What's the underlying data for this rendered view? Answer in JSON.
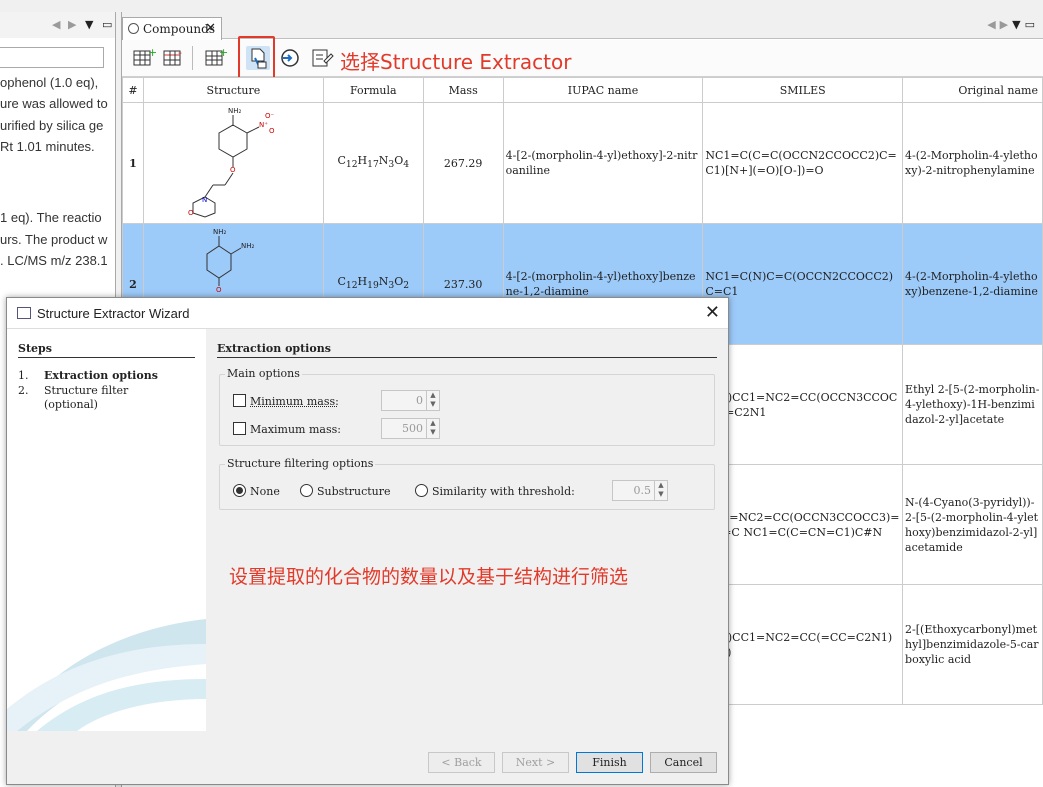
{
  "left_doc": {
    "lines": [
      "ophenol (1.0 eq),",
      "ure was allowed to",
      "urified by silica ge",
      "Rt 1.01 minutes.",
      "1 eq). The reactio",
      "urs. The product w",
      ". LC/MS m/z 238.1"
    ]
  },
  "editor": {
    "tab_label": "Compounds",
    "annotation": "选择Structure Extractor",
    "columns": [
      "#",
      "Structure",
      "Formula",
      "Mass",
      "IUPAC name",
      "SMILES",
      "Original name"
    ],
    "rows": [
      {
        "num": "1",
        "formula_html": "C<sub>12</sub>H<sub>17</sub>N<sub>3</sub>O<sub>4</sub>",
        "mass": "267.29",
        "iupac": "4-[2-(morpholin-4-yl)ethoxy]-2-nitroaniline",
        "smiles": "NC1=C(C=C(OCCN2CCOCC2)C=C1)[N+](=O)[O-])=O",
        "original": "4-(2-Morpholin-4-ylethoxy)-2-nitrophenylamine"
      },
      {
        "num": "2",
        "formula_html": "C<sub>12</sub>H<sub>19</sub>N<sub>3</sub>O<sub>2</sub>",
        "mass": "237.30",
        "iupac": "4-[2-(morpholin-4-yl)ethoxy]benzene-1,2-diamine",
        "smiles": "NC1=C(N)C=C(OCCN2CCOCC2)C=C1",
        "original": "4-(2-Morpholin-4-ylethoxy)benzene-1,2-diamine"
      },
      {
        "num": "3",
        "formula_html": "",
        "mass": "",
        "iupac": "",
        "smiles": "(=O)CC1=NC2=CC(OCCN3CCOCC3)=C2N1",
        "original": "Ethyl 2-[5-(2-morpholin-4-ylethoxy)-1H-benzimidazol-2-yl]acetate"
      },
      {
        "num": "4",
        "formula_html": "",
        "mass": "",
        "iupac": "",
        "smiles": "CC1=NC2=CC(OCCN3CCOCC3)=CC=C NC1=C(C=CN=C1)C#N",
        "original": "N-(4-Cyano(3-pyridyl))-2-[5-(2-morpholin-4-ylethoxy)benzimidazol-2-yl]acetamide"
      },
      {
        "num": "5",
        "formula_html": "",
        "mass": "",
        "iupac": "",
        "smiles": "(=O)CC1=NC2=CC(=CC=C2N1)C(O)",
        "original": "2-[(Ethoxycarbonyl)methyl]benzimidazole-5-carboxylic acid"
      }
    ]
  },
  "dialog": {
    "title": "Structure Extractor Wizard",
    "steps_header": "Steps",
    "steps": [
      {
        "n": "1.",
        "label": "Extraction options",
        "active": true
      },
      {
        "n": "2.",
        "label": "Structure filter (optional)",
        "active": false
      }
    ],
    "content_header": "Extraction options",
    "main_options_title": "Main options",
    "min_mass_label": "Minimum mass:",
    "min_mass_value": "0",
    "max_mass_label": "Maximum mass:",
    "max_mass_value": "500",
    "filter_title": "Structure filtering options",
    "radio_none": "None",
    "radio_sub": "Substructure",
    "radio_sim": "Similarity with threshold:",
    "threshold_value": "0.5",
    "annotation": "设置提取的化合物的数量以及基于结构进行筛选",
    "btn_back": "< Back",
    "btn_next": "Next >",
    "btn_finish": "Finish",
    "btn_cancel": "Cancel"
  }
}
